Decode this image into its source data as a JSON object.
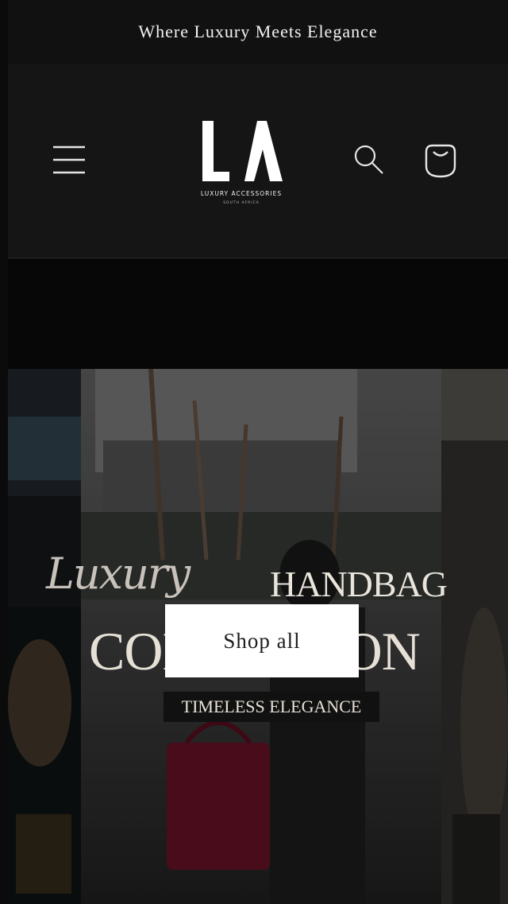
{
  "announcement": {
    "text": "Where Luxury Meets Elegance"
  },
  "header": {
    "menu_icon": "hamburger-menu-icon",
    "logo": {
      "mark": "LA",
      "name": "LUXURY ACCESSORIES",
      "sub": "SOUTH AFRICA"
    },
    "search_icon": "search-icon",
    "cart_icon": "shopping-bag-icon"
  },
  "hero": {
    "script_text": "Luxury",
    "handbag_text": "HANDBAG",
    "collection_text": "COLLECTION",
    "tagline": "TIMELESS ELEGANCE",
    "cta_label": "Shop all"
  },
  "colors": {
    "announcement_bg": "#111111",
    "header_bg": "#151515",
    "page_bg": "#0a0a0a",
    "button_bg": "#ffffff",
    "button_text": "#1d1d1d"
  }
}
